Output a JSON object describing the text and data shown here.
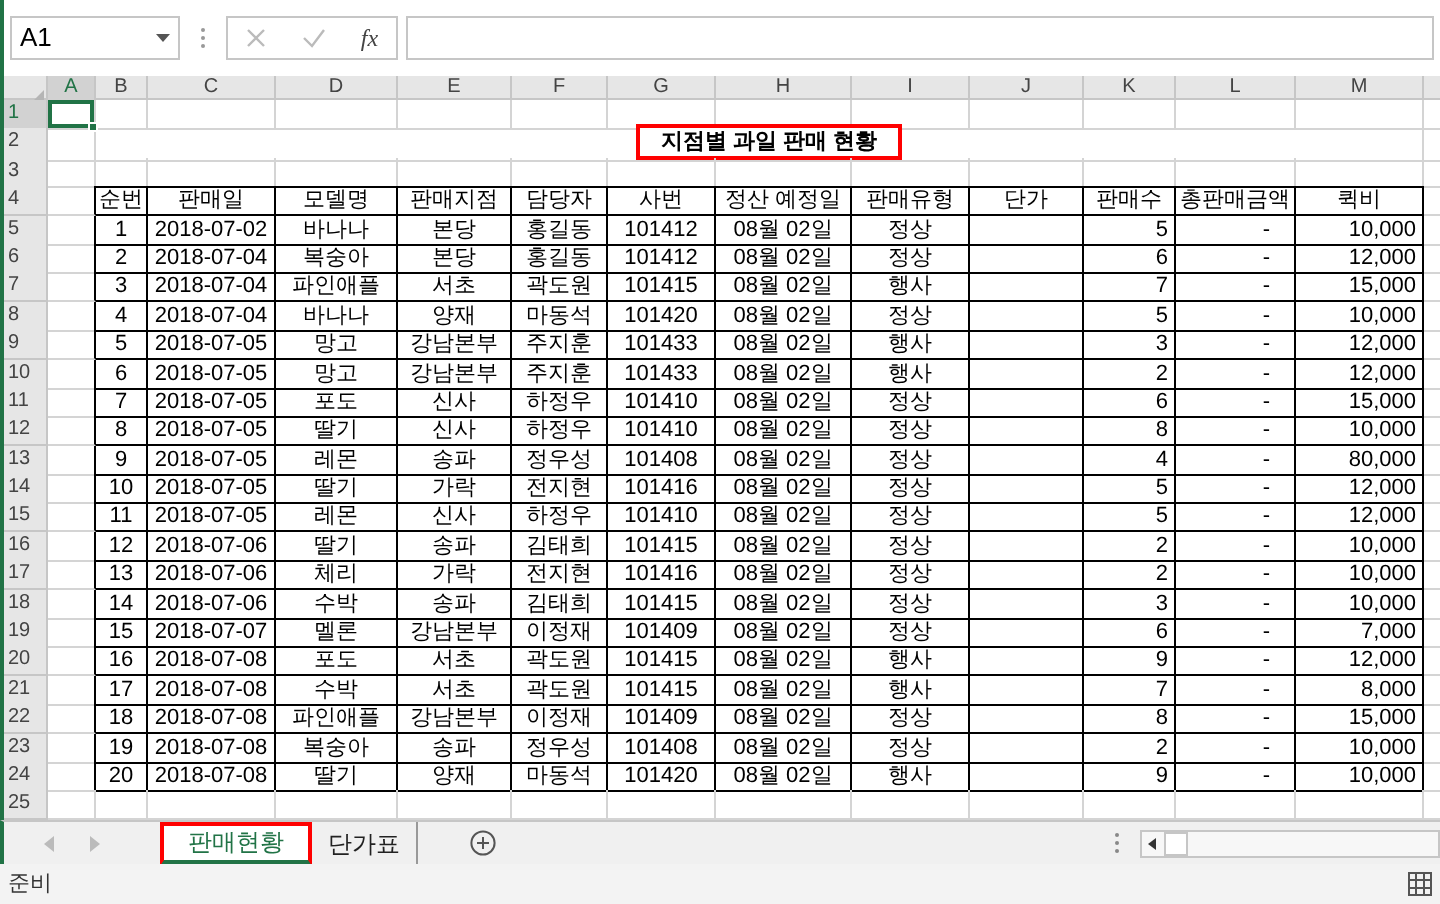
{
  "name_box": {
    "value": "A1"
  },
  "formula_bar": {
    "fx": "fx"
  },
  "column_letters": [
    {
      "label": "A",
      "selected": true
    },
    {
      "label": "B",
      "selected": false
    },
    {
      "label": "C",
      "selected": false
    },
    {
      "label": "D",
      "selected": false
    },
    {
      "label": "E",
      "selected": false
    },
    {
      "label": "F",
      "selected": false
    },
    {
      "label": "G",
      "selected": false
    },
    {
      "label": "H",
      "selected": false
    },
    {
      "label": "I",
      "selected": false
    },
    {
      "label": "J",
      "selected": false
    },
    {
      "label": "K",
      "selected": false
    },
    {
      "label": "L",
      "selected": false
    },
    {
      "label": "M",
      "selected": false
    }
  ],
  "row_numbers": [
    {
      "label": "1",
      "selected": true
    },
    {
      "label": "2",
      "selected": false
    },
    {
      "label": "3",
      "selected": false
    },
    {
      "label": "4",
      "selected": false
    },
    {
      "label": "5",
      "selected": false
    },
    {
      "label": "6",
      "selected": false
    },
    {
      "label": "7",
      "selected": false
    },
    {
      "label": "8",
      "selected": false
    },
    {
      "label": "9",
      "selected": false
    },
    {
      "label": "10",
      "selected": false
    },
    {
      "label": "11",
      "selected": false
    },
    {
      "label": "12",
      "selected": false
    },
    {
      "label": "13",
      "selected": false
    },
    {
      "label": "14",
      "selected": false
    },
    {
      "label": "15",
      "selected": false
    },
    {
      "label": "16",
      "selected": false
    },
    {
      "label": "17",
      "selected": false
    },
    {
      "label": "18",
      "selected": false
    },
    {
      "label": "19",
      "selected": false
    },
    {
      "label": "20",
      "selected": false
    },
    {
      "label": "21",
      "selected": false
    },
    {
      "label": "22",
      "selected": false
    },
    {
      "label": "23",
      "selected": false
    },
    {
      "label": "24",
      "selected": false
    },
    {
      "label": "25",
      "selected": false
    }
  ],
  "title": "지점별 과일 판매 현황",
  "headers": [
    "순번",
    "판매일",
    "모델명",
    "판매지점",
    "담당자",
    "사번",
    "정산 예정일",
    "판매유형",
    "단가",
    "판매수",
    "총판매금액",
    "퀵비"
  ],
  "rows": [
    [
      "1",
      "2018-07-02",
      "바나나",
      "본당",
      "홍길동",
      "101412",
      "08월 02일",
      "정상",
      null,
      "5",
      "-",
      "10,000"
    ],
    [
      "2",
      "2018-07-04",
      "복숭아",
      "본당",
      "홍길동",
      "101412",
      "08월 02일",
      "정상",
      null,
      "6",
      "-",
      "12,000"
    ],
    [
      "3",
      "2018-07-04",
      "파인애플",
      "서초",
      "곽도원",
      "101415",
      "08월 02일",
      "행사",
      null,
      "7",
      "-",
      "15,000"
    ],
    [
      "4",
      "2018-07-04",
      "바나나",
      "양재",
      "마동석",
      "101420",
      "08월 02일",
      "정상",
      null,
      "5",
      "-",
      "10,000"
    ],
    [
      "5",
      "2018-07-05",
      "망고",
      "강남본부",
      "주지훈",
      "101433",
      "08월 02일",
      "행사",
      null,
      "3",
      "-",
      "12,000"
    ],
    [
      "6",
      "2018-07-05",
      "망고",
      "강남본부",
      "주지훈",
      "101433",
      "08월 02일",
      "행사",
      null,
      "2",
      "-",
      "12,000"
    ],
    [
      "7",
      "2018-07-05",
      "포도",
      "신사",
      "하정우",
      "101410",
      "08월 02일",
      "정상",
      null,
      "6",
      "-",
      "15,000"
    ],
    [
      "8",
      "2018-07-05",
      "딸기",
      "신사",
      "하정우",
      "101410",
      "08월 02일",
      "정상",
      null,
      "8",
      "-",
      "10,000"
    ],
    [
      "9",
      "2018-07-05",
      "레몬",
      "송파",
      "정우성",
      "101408",
      "08월 02일",
      "정상",
      null,
      "4",
      "-",
      "80,000"
    ],
    [
      "10",
      "2018-07-05",
      "딸기",
      "가락",
      "전지현",
      "101416",
      "08월 02일",
      "정상",
      null,
      "5",
      "-",
      "12,000"
    ],
    [
      "11",
      "2018-07-05",
      "레몬",
      "신사",
      "하정우",
      "101410",
      "08월 02일",
      "정상",
      null,
      "5",
      "-",
      "12,000"
    ],
    [
      "12",
      "2018-07-06",
      "딸기",
      "송파",
      "김태희",
      "101415",
      "08월 02일",
      "정상",
      null,
      "2",
      "-",
      "10,000"
    ],
    [
      "13",
      "2018-07-06",
      "체리",
      "가락",
      "전지현",
      "101416",
      "08월 02일",
      "정상",
      null,
      "2",
      "-",
      "10,000"
    ],
    [
      "14",
      "2018-07-06",
      "수박",
      "송파",
      "김태희",
      "101415",
      "08월 02일",
      "정상",
      null,
      "3",
      "-",
      "10,000"
    ],
    [
      "15",
      "2018-07-07",
      "멜론",
      "강남본부",
      "이정재",
      "101409",
      "08월 02일",
      "정상",
      null,
      "6",
      "-",
      "7,000"
    ],
    [
      "16",
      "2018-07-08",
      "포도",
      "서초",
      "곽도원",
      "101415",
      "08월 02일",
      "행사",
      null,
      "9",
      "-",
      "12,000"
    ],
    [
      "17",
      "2018-07-08",
      "수박",
      "서초",
      "곽도원",
      "101415",
      "08월 02일",
      "행사",
      null,
      "7",
      "-",
      "8,000"
    ],
    [
      "18",
      "2018-07-08",
      "파인애플",
      "강남본부",
      "이정재",
      "101409",
      "08월 02일",
      "정상",
      null,
      "8",
      "-",
      "15,000"
    ],
    [
      "19",
      "2018-07-08",
      "복숭아",
      "송파",
      "정우성",
      "101408",
      "08월 02일",
      "정상",
      null,
      "2",
      "-",
      "10,000"
    ],
    [
      "20",
      "2018-07-08",
      "딸기",
      "양재",
      "마동석",
      "101420",
      "08월 02일",
      "행사",
      null,
      "9",
      "-",
      "10,000"
    ]
  ],
  "sheet_tabs": [
    {
      "label": "판매현황",
      "selected": true
    },
    {
      "label": "단가표",
      "selected": false
    }
  ],
  "status_bar": {
    "text": "준비"
  }
}
